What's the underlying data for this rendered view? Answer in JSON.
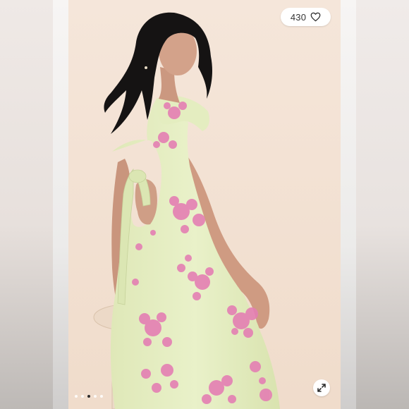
{
  "listing": {
    "likes": {
      "count": "430",
      "icon": "heart-outline-icon"
    },
    "expand": {
      "icon": "expand-arrows-icon"
    },
    "carousel": {
      "slide_count": 5,
      "active_index": 2
    }
  },
  "colors": {
    "backdrop": "#f3e2d5",
    "dress": "#e6efc4",
    "print": "#e47fb3",
    "hair": "#151313",
    "skin": "#cf9e86",
    "stool": "#ead6c3",
    "active_dot": "#2b2b2b"
  }
}
